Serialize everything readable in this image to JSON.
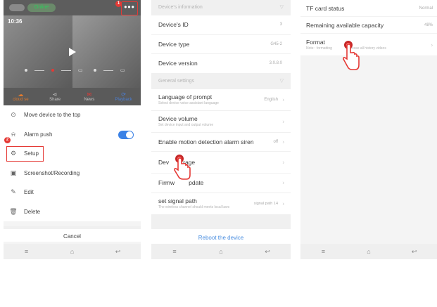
{
  "panel1": {
    "status": "Online",
    "timestamp": "10:36",
    "more_icon": "•••",
    "step_one": "1",
    "step_two": "2",
    "toolbar": [
      {
        "label": "cloud se",
        "icon": "cloud-icon"
      },
      {
        "label": "Share",
        "icon": "share-icon"
      },
      {
        "label": "News",
        "icon": "news-icon"
      },
      {
        "label": "Playback",
        "icon": "playback-icon"
      }
    ],
    "menu": [
      {
        "label": "Move device to the top",
        "icon": "top-icon"
      },
      {
        "label": "Alarm push",
        "icon": "bell-icon"
      },
      {
        "label": "Setup",
        "icon": "gear-icon"
      },
      {
        "label": "Screenshot/Recording",
        "icon": "image-icon"
      },
      {
        "label": "Edit",
        "icon": "pencil-icon"
      },
      {
        "label": "Delete",
        "icon": "trash-icon"
      }
    ],
    "alarm_push_on": true,
    "cancel": "Cancel"
  },
  "panel2": {
    "section_info": "Device's information",
    "device_id_label": "Device's ID",
    "device_id_value": "3",
    "device_type_label": "Device type",
    "device_type_value": "G45-2",
    "device_version_label": "Device version",
    "device_version_value": "3.0.8.0",
    "section_general": "General settings",
    "language_label": "Language of prompt",
    "language_sub": "Select device voice assistant language",
    "language_value": "English",
    "volume_label": "Device volume",
    "volume_sub": "Set device input and output volume",
    "motion_label": "Enable motion detection alarm siren",
    "motion_value": "off",
    "storage_label_a": "Dev",
    "storage_label_b": "rage",
    "firmware_label_a": "Firmw",
    "firmware_label_b": "pdate",
    "signal_label": "set signal path",
    "signal_sub": "The wireless channel should meets local laws",
    "signal_value": "signal path 14",
    "reboot": "Reboot the device"
  },
  "panel3": {
    "tf_label": "TF card status",
    "tf_value": "Normal",
    "remaining_label": "Remaining available capacity",
    "remaining_value": "48%",
    "format_label": "Format",
    "format_sub_a": "Note : formatting",
    "format_sub_b": "erase all history videos"
  },
  "colors": {
    "accent_blue": "#3b82e6",
    "highlight_red": "#e53935",
    "online_green": "#2ecc5c",
    "link_blue": "#4a8ee0"
  }
}
